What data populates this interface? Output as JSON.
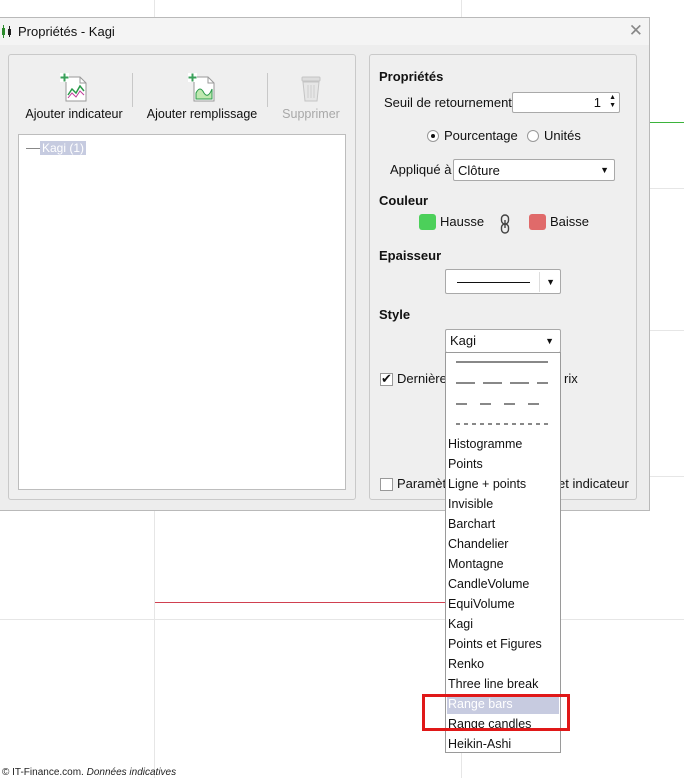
{
  "dialog": {
    "title": "Propriétés - Kagi",
    "close_symbol": "✕"
  },
  "toolbar": {
    "add_indicator_label": "Ajouter indicateur",
    "add_fill_label": "Ajouter remplissage",
    "delete_label": "Supprimer"
  },
  "tree": {
    "items": [
      {
        "label": "Kagi (1)"
      }
    ]
  },
  "properties": {
    "section_title": "Propriétés",
    "threshold_label": "Seuil de retournement",
    "threshold_value": "1",
    "radio_percentage_label": "Pourcentage",
    "radio_units_label": "Unités",
    "radio_selected": "Pourcentage",
    "applied_to_label": "Appliqué à",
    "applied_to_value": "Clôture"
  },
  "color": {
    "section_title": "Couleur",
    "up_label": "Hausse",
    "up_color": "#4cd05a",
    "down_label": "Baisse",
    "down_color": "#e06a6a"
  },
  "thickness": {
    "section_title": "Epaisseur"
  },
  "style": {
    "section_title": "Style",
    "selected_value": "Kagi",
    "last_price_label_start": "Dernière",
    "last_price_label_end": "rix",
    "last_price_checked": true,
    "params_label_start": "Paramèt",
    "params_label_end": "et indicateur",
    "params_checked": false
  },
  "dropdown": {
    "options": [
      "Histogramme",
      "Points",
      "Ligne + points",
      "Invisible",
      "Barchart",
      "Chandelier",
      "Montagne",
      "CandleVolume",
      "EquiVolume",
      "Kagi",
      "Points et Figures",
      "Renko",
      "Three line break",
      "Range bars",
      "Range candles",
      "Heikin-Ashi"
    ],
    "highlighted": "Range bars"
  },
  "footer": {
    "copyright": "© IT-Finance.com.",
    "note": "Données indicatives"
  },
  "colors": {
    "highlight_box": "#e01818",
    "selection_bg": "#c7cbe0",
    "chart_green": "#3bb33b",
    "chart_red": "#d04050"
  }
}
